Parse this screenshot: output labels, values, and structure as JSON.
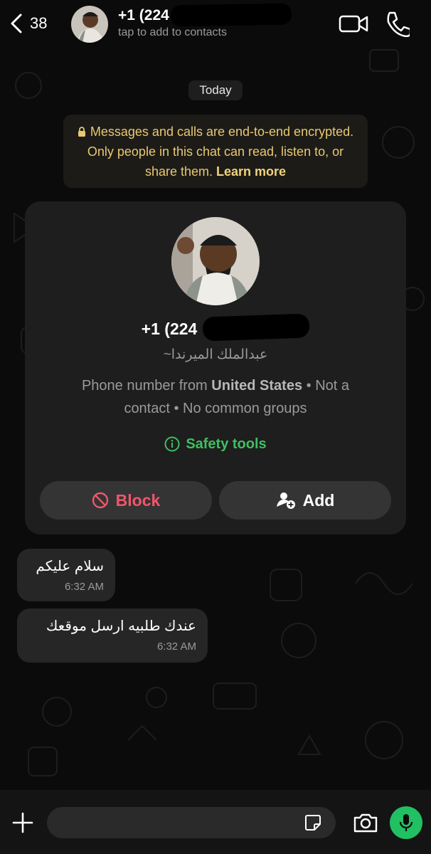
{
  "header": {
    "back_count": "38",
    "contact_name": "+1 (224",
    "contact_subtitle": "tap to add to contacts"
  },
  "chat": {
    "date_label": "Today",
    "encryption_notice": "Messages and calls are end-to-end encrypted. Only people in this chat can read, listen to, or share them.",
    "learn_more": "Learn more"
  },
  "profile_card": {
    "phone": "+1 (224",
    "push_name": "~عبدالملك الميرندا",
    "info_prefix": "Phone number from",
    "info_country": "United States",
    "info_suffix": "• Not a contact • No common groups",
    "safety_tools": "Safety tools",
    "block_label": "Block",
    "add_label": "Add"
  },
  "messages": [
    {
      "text": "سلام عليكم",
      "time": "6:32 AM"
    },
    {
      "text": "عندك طلبيه ارسل موقعك",
      "time": "6:32 AM"
    }
  ],
  "input": {
    "placeholder": ""
  },
  "colors": {
    "accent_green": "#21c063",
    "safety_green": "#3fbf62",
    "block_red": "#f0566b",
    "notice_yellow": "#e9c872"
  }
}
